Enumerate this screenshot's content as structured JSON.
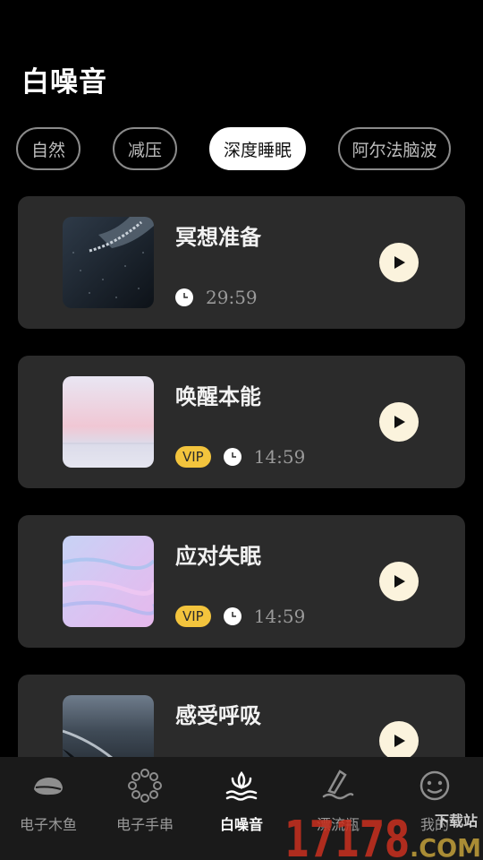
{
  "header": {
    "title": "白噪音"
  },
  "tabs": [
    {
      "label": "自然",
      "active": false
    },
    {
      "label": "减压",
      "active": false
    },
    {
      "label": "深度睡眠",
      "active": true
    },
    {
      "label": "阿尔法脑波",
      "active": false
    }
  ],
  "tracks": [
    {
      "title": "冥想准备",
      "duration": "29:59",
      "vip": false,
      "thumbnail": "dark-water-rope"
    },
    {
      "title": "唤醒本能",
      "duration": "14:59",
      "vip": true,
      "vip_label": "VIP",
      "thumbnail": "pastel-sky-horizon"
    },
    {
      "title": "应对失眠",
      "duration": "14:59",
      "vip": true,
      "vip_label": "VIP",
      "thumbnail": "lavender-brushstrokes"
    },
    {
      "title": "感受呼吸",
      "duration": "",
      "vip": false,
      "thumbnail": "dark-beach-waves"
    }
  ],
  "bottom_nav": [
    {
      "label": "电子木鱼",
      "icon": "wooden-fish-icon",
      "active": false
    },
    {
      "label": "电子手串",
      "icon": "bead-bracelet-icon",
      "active": false
    },
    {
      "label": "白噪音",
      "icon": "lotus-water-icon",
      "active": true
    },
    {
      "label": "漂流瓶",
      "icon": "drift-bottle-icon",
      "active": false
    },
    {
      "label": "我的",
      "icon": "smiley-face-icon",
      "active": false
    }
  ],
  "watermark": {
    "number": "17178",
    "text": "下载站",
    "domain": ".COM"
  },
  "colors": {
    "background": "#000000",
    "card": "#2b2b2b",
    "vip_badge": "#f3c43d",
    "play_button": "#fbf3dd",
    "nav_bar": "#1a1a1a"
  }
}
